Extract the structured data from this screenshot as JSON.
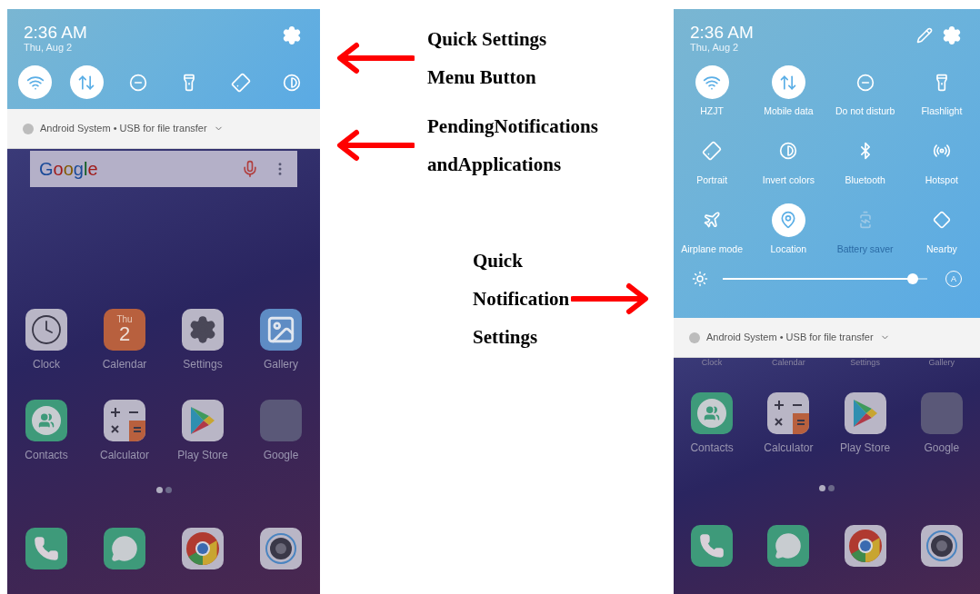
{
  "phones": [
    {
      "time": "2:36 AM",
      "date": "Thu, Aug 2",
      "toggles": [
        {
          "kind": "wifi",
          "on": true
        },
        {
          "kind": "data",
          "on": true
        },
        {
          "kind": "dnd",
          "on": false
        },
        {
          "kind": "flashlight",
          "on": false
        },
        {
          "kind": "rotate",
          "on": false
        },
        {
          "kind": "invert",
          "on": false
        }
      ],
      "notification": "Android System • USB for file transfer",
      "search": {
        "logo": "Google"
      },
      "app_rows": [
        [
          {
            "kind": "clock",
            "label": "Clock"
          },
          {
            "kind": "calendar",
            "label": "Calendar",
            "icon_text": [
              "Thu",
              "2"
            ]
          },
          {
            "kind": "settings",
            "label": "Settings"
          },
          {
            "kind": "gallery",
            "label": "Gallery"
          }
        ],
        [
          {
            "kind": "contacts",
            "label": "Contacts"
          },
          {
            "kind": "calculator",
            "label": "Calculator"
          },
          {
            "kind": "playstore",
            "label": "Play Store"
          },
          {
            "kind": "folder",
            "label": "Google"
          }
        ]
      ],
      "page_dots": [
        {
          "selected": true
        },
        {
          "selected": false
        }
      ],
      "dock": [
        {
          "kind": "phone"
        },
        {
          "kind": "messages"
        },
        {
          "kind": "chrome"
        },
        {
          "kind": "camera"
        }
      ]
    },
    {
      "edit_button": true,
      "time": "2:36 AM",
      "date": "Thu, Aug 2",
      "tiles": [
        {
          "kind": "wifi",
          "label": "HZJT",
          "on": true,
          "disabled": false
        },
        {
          "kind": "data",
          "label": "Mobile data",
          "on": true,
          "disabled": false
        },
        {
          "kind": "dnd",
          "label": "Do not disturb",
          "on": false,
          "disabled": false
        },
        {
          "kind": "flashlight",
          "label": "Flashlight",
          "on": false,
          "disabled": false
        },
        {
          "kind": "rotate",
          "label": "Portrait",
          "on": false,
          "disabled": false
        },
        {
          "kind": "invert",
          "label": "Invert colors",
          "on": false,
          "disabled": false
        },
        {
          "kind": "bluetooth",
          "label": "Bluetooth",
          "on": false,
          "disabled": false
        },
        {
          "kind": "hotspot",
          "label": "Hotspot",
          "on": false,
          "disabled": false
        },
        {
          "kind": "airplane",
          "label": "Airplane mode",
          "on": false,
          "disabled": false
        },
        {
          "kind": "location",
          "label": "Location",
          "on": true,
          "disabled": false
        },
        {
          "kind": "battery",
          "label": "Battery saver",
          "on": false,
          "disabled": true
        },
        {
          "kind": "nearby",
          "label": "Nearby",
          "on": false,
          "disabled": false
        }
      ],
      "brightness": {
        "level": 0.93,
        "auto": "A"
      },
      "notification": "Android System • USB for file transfer",
      "cut_labels": [
        "Clock",
        "Calendar",
        "Settings",
        "Gallery"
      ],
      "app_rows": [
        [
          {
            "kind": "contacts",
            "label": "Contacts"
          },
          {
            "kind": "calculator",
            "label": "Calculator"
          },
          {
            "kind": "playstore",
            "label": "Play Store"
          },
          {
            "kind": "folder",
            "label": "Google"
          }
        ]
      ],
      "page_dots": [
        {
          "selected": true
        },
        {
          "selected": false
        }
      ],
      "dock": [
        {
          "kind": "phone"
        },
        {
          "kind": "messages"
        },
        {
          "kind": "chrome"
        },
        {
          "kind": "camera"
        }
      ]
    }
  ],
  "annotations": [
    {
      "kind": "left_arrow",
      "lines": [
        "Quick Settings",
        "Menu Button"
      ]
    },
    {
      "kind": "left_arrow",
      "lines": [
        "PendingNotifications",
        "andApplications"
      ]
    },
    {
      "kind": "right_arrow",
      "lines": [
        "Quick",
        "Notification",
        "Settings"
      ]
    }
  ]
}
